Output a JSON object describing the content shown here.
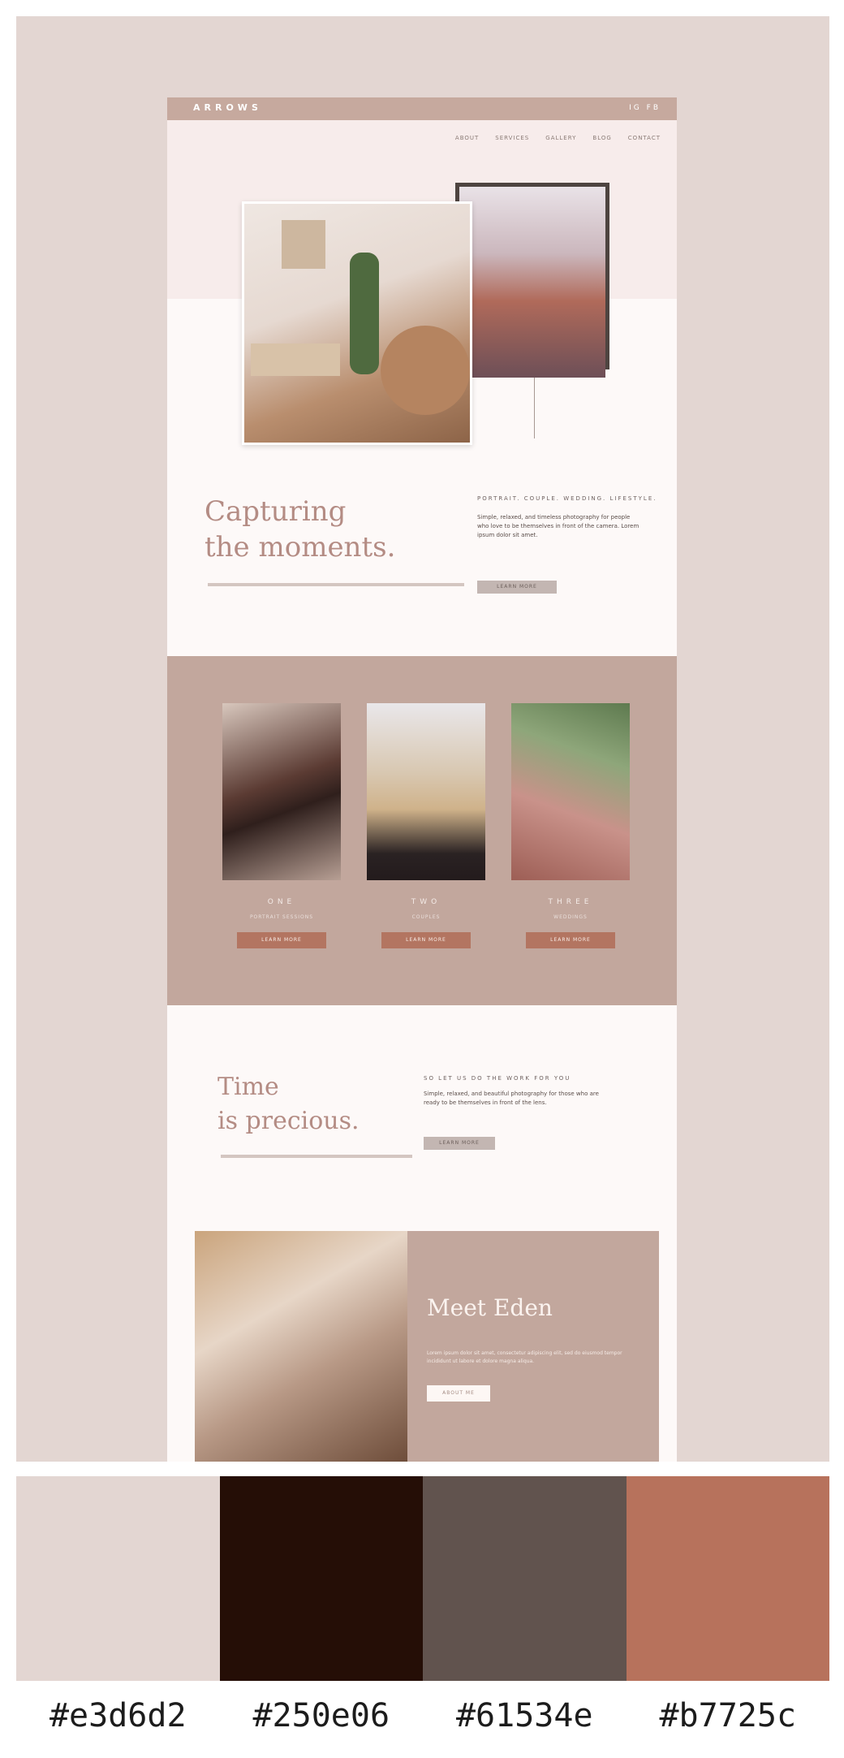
{
  "site": {
    "logo": "ARROWS",
    "social": "IG FB",
    "nav": [
      "ABOUT",
      "SERVICES",
      "GALLERY",
      "BLOG",
      "CONTACT"
    ]
  },
  "hero": {
    "heading_line1": "Capturing",
    "heading_line2": "the moments.",
    "subheading": "PORTRAIT. COUPLE. WEDDING. LIFESTYLE.",
    "paragraph": "Simple, relaxed, and timeless photography for people who love to be themselves in front of the camera. Lorem ipsum dolor sit amet.",
    "button": "LEARN MORE"
  },
  "services": [
    {
      "title": "ONE",
      "subtitle": "PORTRAIT SESSIONS",
      "button": "LEARN MORE"
    },
    {
      "title": "TWO",
      "subtitle": "COUPLES",
      "button": "LEARN MORE"
    },
    {
      "title": "THREE",
      "subtitle": "WEDDINGS",
      "button": "LEARN MORE"
    }
  ],
  "time": {
    "heading_line1": "Time",
    "heading_line2": "is precious.",
    "subheading": "SO LET US DO THE WORK FOR YOU",
    "paragraph": "Simple, relaxed, and beautiful photography for those who are ready to be themselves in front of the lens.",
    "button": "LEARN MORE"
  },
  "about": {
    "heading": "Meet Eden",
    "paragraph": "Lorem ipsum dolor sit amet, consectetur adipiscing elit, sed do eiusmod tempor incididunt ut labore et dolore magna aliqua.",
    "button": "ABOUT ME"
  },
  "palette": {
    "colors": [
      "#e3d6d2",
      "#250e06",
      "#61534e",
      "#b7725c"
    ],
    "codes": [
      "#e3d6d2",
      "#250e06",
      "#61534e",
      "#b7725c"
    ]
  }
}
